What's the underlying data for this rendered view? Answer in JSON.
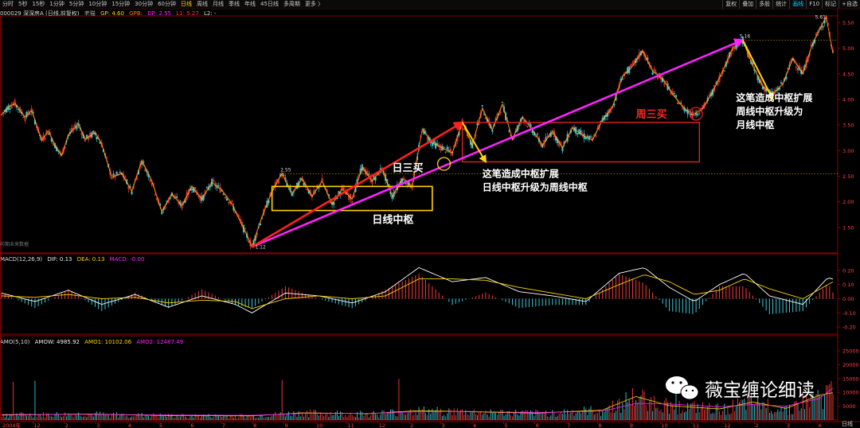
{
  "toolbar": {
    "tabs": [
      "分时",
      "5秒",
      "15秒",
      "1分钟",
      "5分钟",
      "10分钟",
      "15分钟",
      "30分钟",
      "60分钟",
      "日线",
      "周线",
      "月线",
      "季线",
      "年线",
      "45日线",
      "多周期",
      "更多 〉"
    ],
    "active_tab": "日线",
    "right_buttons": [
      "复权",
      "叠加",
      "多股",
      "统计",
      "画线",
      "F10",
      "标记",
      "+自选"
    ],
    "active_right": "画线"
  },
  "main_info": {
    "code_name": "000029 深深房A (日线,前复权)",
    "indicator_name": "老猫",
    "gp": "GP: 4.60",
    "gpb": "GPB:",
    "dp": "DP: 2.55",
    "l1": "L1: 5.27",
    "l2": "L2: -"
  },
  "macd_info": {
    "name": "MACD(12,26,9)",
    "dif": "DIF: 0.13",
    "dea": "DEA: 0.13",
    "macd": "MACD: -0.00"
  },
  "amo_info": {
    "name": "AMO(5,10)",
    "amow": "AMOW: 4985.92",
    "amo1": "AMO1: 10102.06",
    "amo2": "AMO2: 12487.49"
  },
  "misc": {
    "watermark_label": "前期未来数据",
    "bottom_right_label": "日线"
  },
  "colors": {
    "up": "#ff3b3b",
    "down": "#3cc8d8",
    "yellow": "#ffd400",
    "magenta": "#ff22ff",
    "red_arrow": "#ff2020",
    "white": "#ffffff",
    "axis": "#8b0000"
  },
  "chart_data": [
    {
      "type": "candlestick",
      "panel": "price",
      "ylim": [
        1.0,
        5.6
      ],
      "y_ticks": [
        1.5,
        2.0,
        2.5,
        3.0,
        3.5,
        4.0,
        4.5,
        5.0,
        5.5
      ],
      "close_path": [
        [
          0,
          3.7
        ],
        [
          4,
          3.85
        ],
        [
          8,
          3.92
        ],
        [
          14,
          3.65
        ],
        [
          18,
          3.78
        ],
        [
          24,
          3.2
        ],
        [
          28,
          3.38
        ],
        [
          32,
          3.1
        ],
        [
          36,
          2.9
        ],
        [
          40,
          3.3
        ],
        [
          46,
          3.52
        ],
        [
          50,
          3.22
        ],
        [
          56,
          3.35
        ],
        [
          60,
          3.12
        ],
        [
          66,
          2.48
        ],
        [
          72,
          2.55
        ],
        [
          78,
          2.2
        ],
        [
          84,
          2.8
        ],
        [
          90,
          2.4
        ],
        [
          96,
          1.8
        ],
        [
          102,
          2.15
        ],
        [
          108,
          1.92
        ],
        [
          114,
          2.3
        ],
        [
          120,
          2.05
        ],
        [
          126,
          2.38
        ],
        [
          132,
          2.22
        ],
        [
          138,
          1.95
        ],
        [
          144,
          1.55
        ],
        [
          150,
          1.12
        ],
        [
          156,
          1.7
        ],
        [
          162,
          2.2
        ],
        [
          168,
          2.55
        ],
        [
          174,
          2.15
        ],
        [
          180,
          2.45
        ],
        [
          186,
          2.1
        ],
        [
          192,
          2.4
        ],
        [
          198,
          1.95
        ],
        [
          204,
          2.25
        ],
        [
          210,
          2.05
        ],
        [
          216,
          2.68
        ],
        [
          222,
          2.4
        ],
        [
          228,
          2.65
        ],
        [
          234,
          2.1
        ],
        [
          240,
          2.45
        ],
        [
          246,
          2.3
        ],
        [
          252,
          3.42
        ],
        [
          258,
          3.15
        ],
        [
          264,
          3.05
        ],
        [
          270,
          2.95
        ],
        [
          276,
          3.55
        ],
        [
          282,
          3.1
        ],
        [
          288,
          3.82
        ],
        [
          294,
          3.4
        ],
        [
          300,
          3.9
        ],
        [
          306,
          3.22
        ],
        [
          312,
          3.65
        ],
        [
          318,
          3.4
        ],
        [
          324,
          3.1
        ],
        [
          330,
          3.38
        ],
        [
          336,
          3.05
        ],
        [
          342,
          3.45
        ],
        [
          348,
          3.3
        ],
        [
          354,
          3.2
        ],
        [
          360,
          3.6
        ],
        [
          366,
          3.85
        ],
        [
          372,
          4.45
        ],
        [
          378,
          4.65
        ],
        [
          384,
          4.95
        ],
        [
          390,
          4.55
        ],
        [
          396,
          4.4
        ],
        [
          402,
          4.1
        ],
        [
          408,
          3.85
        ],
        [
          414,
          3.7
        ],
        [
          420,
          3.82
        ],
        [
          426,
          4.15
        ],
        [
          432,
          4.55
        ],
        [
          438,
          5.0
        ],
        [
          444,
          5.15
        ],
        [
          450,
          4.65
        ],
        [
          456,
          4.25
        ],
        [
          462,
          4.1
        ],
        [
          468,
          4.3
        ],
        [
          474,
          4.8
        ],
        [
          480,
          4.5
        ],
        [
          486,
          5.1
        ],
        [
          490,
          5.35
        ],
        [
          494,
          5.61
        ],
        [
          498,
          4.9
        ]
      ],
      "annotations": {
        "high_label": "5.61",
        "high2_label": "5.16",
        "low_label": "1.12",
        "level_label": "2.55",
        "texts": [
          "日三买",
          "这笔造成中枢扩展",
          "日线中枢升级为周线中枢",
          "日线中枢",
          "周三买",
          "这笔造成中枢扩展",
          "周线中枢升级为",
          "月线中枢"
        ]
      }
    },
    {
      "type": "bar+line",
      "panel": "macd",
      "ylim": [
        -0.25,
        0.25
      ],
      "y_ticks": [
        -0.2,
        -0.1,
        0.0,
        0.1,
        0.2
      ],
      "dif_path": [
        [
          0,
          0.04
        ],
        [
          20,
          -0.02
        ],
        [
          40,
          0.06
        ],
        [
          60,
          -0.04
        ],
        [
          80,
          0.03
        ],
        [
          100,
          -0.06
        ],
        [
          120,
          0.02
        ],
        [
          140,
          -0.04
        ],
        [
          150,
          -0.1
        ],
        [
          170,
          0.04
        ],
        [
          190,
          0.02
        ],
        [
          210,
          -0.03
        ],
        [
          230,
          0.05
        ],
        [
          250,
          0.22
        ],
        [
          270,
          0.12
        ],
        [
          290,
          0.15
        ],
        [
          310,
          0.05
        ],
        [
          330,
          0.02
        ],
        [
          350,
          -0.02
        ],
        [
          370,
          0.18
        ],
        [
          385,
          0.22
        ],
        [
          400,
          0.08
        ],
        [
          415,
          -0.02
        ],
        [
          430,
          0.1
        ],
        [
          445,
          0.18
        ],
        [
          460,
          0.02
        ],
        [
          480,
          -0.04
        ],
        [
          495,
          0.15
        ],
        [
          500,
          0.13
        ]
      ],
      "dea_path": [
        [
          0,
          0.02
        ],
        [
          20,
          0.01
        ],
        [
          40,
          0.03
        ],
        [
          60,
          0.0
        ],
        [
          80,
          0.01
        ],
        [
          100,
          -0.03
        ],
        [
          120,
          -0.01
        ],
        [
          140,
          -0.02
        ],
        [
          150,
          -0.07
        ],
        [
          170,
          0.0
        ],
        [
          190,
          0.02
        ],
        [
          210,
          0.0
        ],
        [
          230,
          0.02
        ],
        [
          250,
          0.14
        ],
        [
          270,
          0.14
        ],
        [
          290,
          0.13
        ],
        [
          310,
          0.08
        ],
        [
          330,
          0.04
        ],
        [
          350,
          0.0
        ],
        [
          370,
          0.1
        ],
        [
          385,
          0.17
        ],
        [
          400,
          0.12
        ],
        [
          415,
          0.03
        ],
        [
          430,
          0.06
        ],
        [
          445,
          0.14
        ],
        [
          460,
          0.07
        ],
        [
          480,
          0.0
        ],
        [
          495,
          0.1
        ],
        [
          500,
          0.13
        ]
      ]
    },
    {
      "type": "bar+line",
      "panel": "amo",
      "ylim": [
        0,
        27000
      ],
      "y_ticks": [
        5000,
        10000,
        15000,
        20000,
        25000
      ],
      "amo1_path": [
        [
          0,
          1800
        ],
        [
          50,
          2200
        ],
        [
          100,
          1600
        ],
        [
          150,
          1500
        ],
        [
          180,
          2600
        ],
        [
          220,
          2300
        ],
        [
          250,
          3400
        ],
        [
          280,
          3000
        ],
        [
          320,
          2500
        ],
        [
          360,
          3600
        ],
        [
          380,
          8500
        ],
        [
          400,
          5200
        ],
        [
          430,
          4000
        ],
        [
          450,
          6500
        ],
        [
          470,
          4200
        ],
        [
          490,
          9000
        ],
        [
          500,
          10100
        ]
      ],
      "amo2_path": [
        [
          0,
          2000
        ],
        [
          50,
          2100
        ],
        [
          100,
          1800
        ],
        [
          150,
          1700
        ],
        [
          180,
          2400
        ],
        [
          220,
          2400
        ],
        [
          250,
          3000
        ],
        [
          280,
          3100
        ],
        [
          320,
          2700
        ],
        [
          360,
          3200
        ],
        [
          380,
          6000
        ],
        [
          400,
          5800
        ],
        [
          430,
          4800
        ],
        [
          450,
          5600
        ],
        [
          470,
          5000
        ],
        [
          490,
          7800
        ],
        [
          500,
          12487
        ]
      ]
    }
  ],
  "x_axis": {
    "labels": [
      "2004年",
      "12",
      "2",
      "3",
      "4",
      "5",
      "6",
      "7",
      "8",
      "9",
      "10",
      "11",
      "12",
      "2",
      "3",
      "4",
      "5",
      "6",
      "7",
      "8",
      "9",
      "10",
      "11",
      "12",
      "2",
      "3",
      "4"
    ]
  },
  "watermark": {
    "brand_text": "薇宝缠论细读"
  }
}
